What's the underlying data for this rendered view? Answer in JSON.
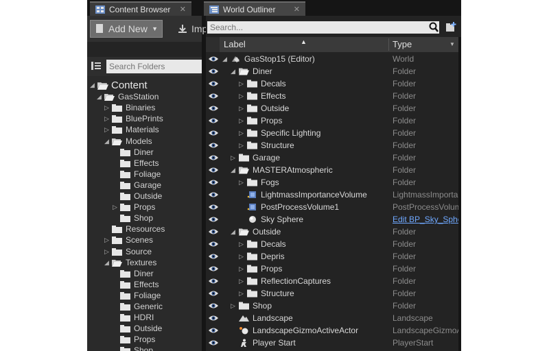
{
  "tabs": {
    "content_browser": "Content Browser",
    "world_outliner": "World Outliner",
    "close_glyph": "✕"
  },
  "content_browser": {
    "add_new": "Add New",
    "import_truncated": "Imp",
    "search_placeholder": "Search Folders",
    "tree": [
      {
        "label": "Content",
        "depth": 0,
        "arrow": "open"
      },
      {
        "label": "GasStation",
        "depth": 1,
        "arrow": "open"
      },
      {
        "label": "Binaries",
        "depth": 2,
        "arrow": "closed"
      },
      {
        "label": "BluePrints",
        "depth": 2,
        "arrow": "closed"
      },
      {
        "label": "Materials",
        "depth": 2,
        "arrow": "closed"
      },
      {
        "label": "Models",
        "depth": 2,
        "arrow": "open"
      },
      {
        "label": "Diner",
        "depth": 3,
        "arrow": "none"
      },
      {
        "label": "Effects",
        "depth": 3,
        "arrow": "none"
      },
      {
        "label": "Foliage",
        "depth": 3,
        "arrow": "none"
      },
      {
        "label": "Garage",
        "depth": 3,
        "arrow": "none"
      },
      {
        "label": "Outside",
        "depth": 3,
        "arrow": "none"
      },
      {
        "label": "Props",
        "depth": 3,
        "arrow": "closed"
      },
      {
        "label": "Shop",
        "depth": 3,
        "arrow": "none"
      },
      {
        "label": "Resources",
        "depth": 2,
        "arrow": "none"
      },
      {
        "label": "Scenes",
        "depth": 2,
        "arrow": "closed"
      },
      {
        "label": "Source",
        "depth": 2,
        "arrow": "closed"
      },
      {
        "label": "Textures",
        "depth": 2,
        "arrow": "open"
      },
      {
        "label": "Diner",
        "depth": 3,
        "arrow": "none"
      },
      {
        "label": "Effects",
        "depth": 3,
        "arrow": "none"
      },
      {
        "label": "Foliage",
        "depth": 3,
        "arrow": "none"
      },
      {
        "label": "Generic",
        "depth": 3,
        "arrow": "none"
      },
      {
        "label": "HDRI",
        "depth": 3,
        "arrow": "none"
      },
      {
        "label": "Outside",
        "depth": 3,
        "arrow": "none"
      },
      {
        "label": "Props",
        "depth": 3,
        "arrow": "none"
      },
      {
        "label": "Shop",
        "depth": 3,
        "arrow": "none"
      }
    ]
  },
  "world_outliner": {
    "search_placeholder": "Search...",
    "columns": {
      "label": "Label",
      "type": "Type"
    },
    "rows": [
      {
        "label": "GasStop15 (Editor)",
        "type": "World",
        "depth": 0,
        "arrow": "open",
        "icon": "world-icon"
      },
      {
        "label": "Diner",
        "type": "Folder",
        "depth": 1,
        "arrow": "open",
        "icon": "folder-open-icon"
      },
      {
        "label": "Decals",
        "type": "Folder",
        "depth": 2,
        "arrow": "closed",
        "icon": "folder-icon"
      },
      {
        "label": "Effects",
        "type": "Folder",
        "depth": 2,
        "arrow": "closed",
        "icon": "folder-icon"
      },
      {
        "label": "Outside",
        "type": "Folder",
        "depth": 2,
        "arrow": "closed",
        "icon": "folder-icon"
      },
      {
        "label": "Props",
        "type": "Folder",
        "depth": 2,
        "arrow": "closed",
        "icon": "folder-icon"
      },
      {
        "label": "Specific Lighting",
        "type": "Folder",
        "depth": 2,
        "arrow": "closed",
        "icon": "folder-icon"
      },
      {
        "label": "Structure",
        "type": "Folder",
        "depth": 2,
        "arrow": "closed",
        "icon": "folder-icon"
      },
      {
        "label": "Garage",
        "type": "Folder",
        "depth": 1,
        "arrow": "closed",
        "icon": "folder-icon"
      },
      {
        "label": "MASTERAtmospheric",
        "type": "Folder",
        "depth": 1,
        "arrow": "open",
        "icon": "folder-open-icon"
      },
      {
        "label": "Fogs",
        "type": "Folder",
        "depth": 2,
        "arrow": "closed",
        "icon": "folder-icon"
      },
      {
        "label": "LightmassImportanceVolume",
        "type": "LightmassImportanceVolume",
        "depth": 2,
        "arrow": "none",
        "icon": "volume-icon"
      },
      {
        "label": "PostProcessVolume1",
        "type": "PostProcessVolume",
        "depth": 2,
        "arrow": "none",
        "icon": "volume-icon"
      },
      {
        "label": "Sky Sphere",
        "type": "Edit BP_Sky_Sphere",
        "depth": 2,
        "arrow": "none",
        "icon": "sphere-icon",
        "link": true
      },
      {
        "label": "Outside",
        "type": "Folder",
        "depth": 1,
        "arrow": "open",
        "icon": "folder-open-icon"
      },
      {
        "label": "Decals",
        "type": "Folder",
        "depth": 2,
        "arrow": "closed",
        "icon": "folder-icon"
      },
      {
        "label": "Depris",
        "type": "Folder",
        "depth": 2,
        "arrow": "closed",
        "icon": "folder-icon"
      },
      {
        "label": "Props",
        "type": "Folder",
        "depth": 2,
        "arrow": "closed",
        "icon": "folder-icon"
      },
      {
        "label": "ReflectionCaptures",
        "type": "Folder",
        "depth": 2,
        "arrow": "closed",
        "icon": "folder-icon"
      },
      {
        "label": "Structure",
        "type": "Folder",
        "depth": 2,
        "arrow": "closed",
        "icon": "folder-icon"
      },
      {
        "label": "Shop",
        "type": "Folder",
        "depth": 1,
        "arrow": "closed",
        "icon": "folder-icon"
      },
      {
        "label": "Landscape",
        "type": "Landscape",
        "depth": 1,
        "arrow": "none",
        "icon": "landscape-icon"
      },
      {
        "label": "LandscapeGizmoActiveActor",
        "type": "LandscapeGizmoActiveActor",
        "depth": 1,
        "arrow": "none",
        "icon": "gizmo-icon"
      },
      {
        "label": "Player Start",
        "type": "PlayerStart",
        "depth": 1,
        "arrow": "none",
        "icon": "player-start-icon"
      }
    ]
  },
  "colors": {
    "panel_bg": "#232323",
    "link": "#6fa8ff",
    "folder": "#e6e6e6",
    "add_new_bg": "#6d6d6d"
  }
}
